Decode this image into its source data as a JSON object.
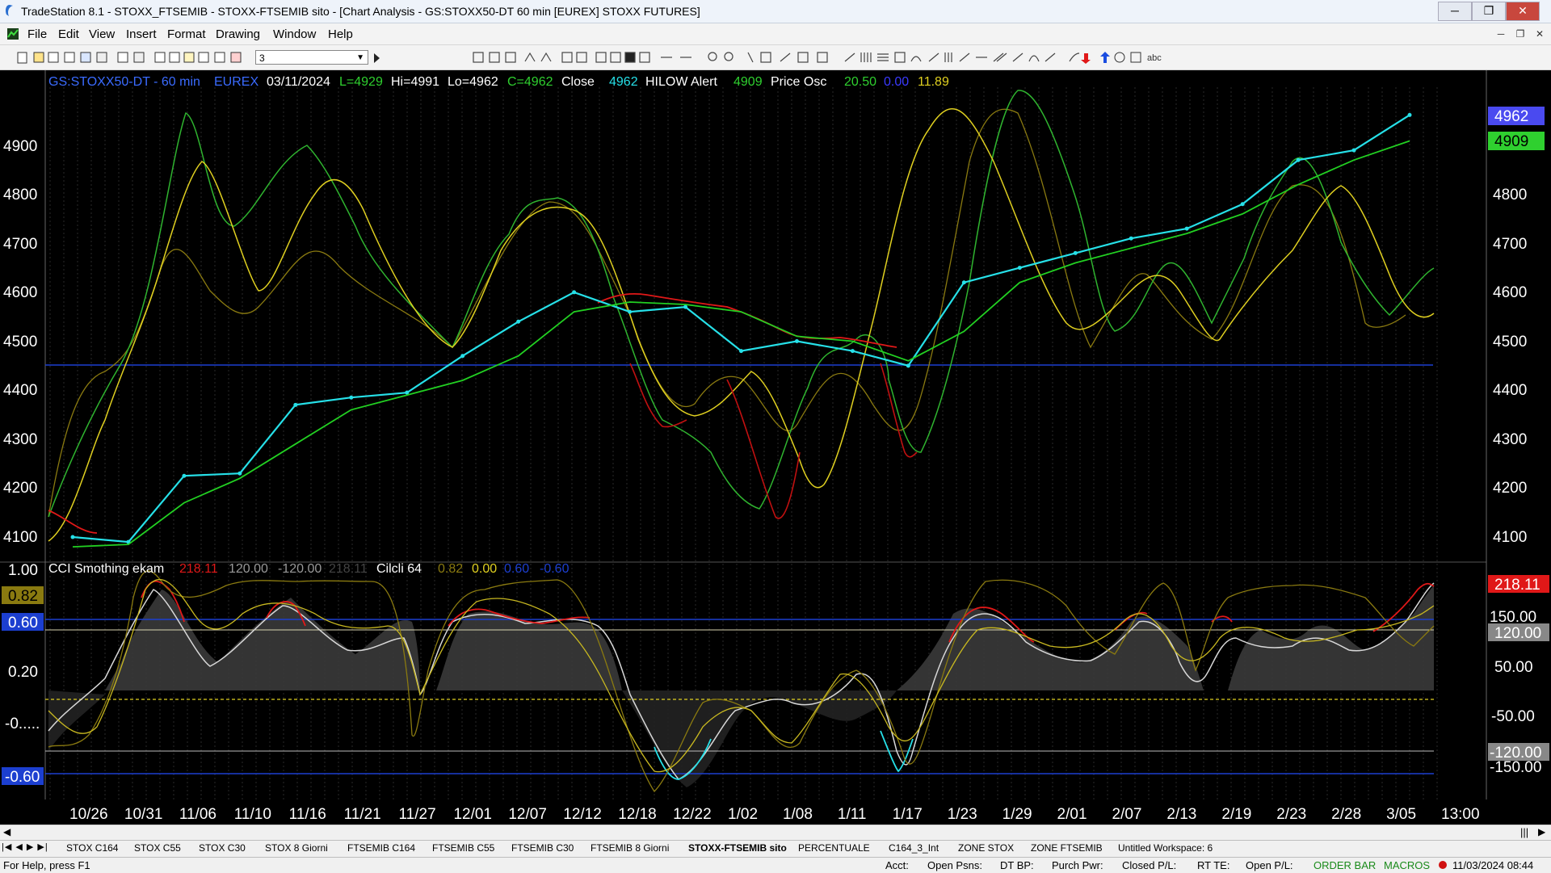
{
  "window": {
    "title": "TradeStation 8.1 - STOXX_FTSEMIB - STOXX-FTSEMIB sito - [Chart Analysis - GS:STOXX50-DT  60 min  [EUREX] STOXX FUTURES]",
    "minimize": "─",
    "maximize": "❐",
    "close": "✕"
  },
  "menu": [
    "File",
    "Edit",
    "View",
    "Insert",
    "Format",
    "Drawing",
    "Window",
    "Help"
  ],
  "toolbar": {
    "interval_value": "3"
  },
  "chart": {
    "header": {
      "symbol": "GS:STOXX50-DT - 60 min",
      "exchange": "EUREX",
      "date": "03/11/2024",
      "low_label": "L=4929",
      "high_label": "Hi=4991",
      "lo_label": "Lo=4962",
      "close_label": "C=4962",
      "close_text": "Close",
      "close_value": "4962",
      "hilow": "HILOW Alert",
      "hilow_value": "4909",
      "price_osc": "Price Osc",
      "osc_v1": "20.50",
      "osc_v2": "0.00",
      "osc_v3": "11.89"
    },
    "price_axis": [
      "4900",
      "4800",
      "4700",
      "4600",
      "4500",
      "4400",
      "4300",
      "4200",
      "4100"
    ],
    "price_badges": {
      "last": "4962",
      "ma": "4909"
    },
    "indicator": {
      "name": "CCI Smothing ekam",
      "v1": "218.11",
      "v2": "120.00",
      "v3": "-120.00",
      "v4": "218.11",
      "name2": "Cilcli 64",
      "w1": "0.82",
      "w2": "0.00",
      "w3": "0.60",
      "w4": "-0.60"
    },
    "left_axis": {
      "top": "1.00",
      "badge_yellow": "0.82",
      "badge_blue": "0.60",
      "mid": "0.20",
      "low": "-0.....",
      "badge_neg": "-0.60"
    },
    "right_axis": {
      "badge_red": "218.11",
      "l150": "150.00",
      "badge_120": "120.00",
      "l50": "50.00",
      "lm50": "-50.00",
      "badge_m120": "-120.00",
      "lm150": "-150.00"
    },
    "dates": [
      "10/26",
      "10/31",
      "11/06",
      "11/10",
      "11/16",
      "11/21",
      "11/27",
      "12/01",
      "12/07",
      "12/12",
      "12/18",
      "12/22",
      "1/02",
      "1/08",
      "1/11",
      "1/17",
      "1/23",
      "1/29",
      "2/01",
      "2/07",
      "2/13",
      "2/19",
      "2/23",
      "2/28",
      "3/05",
      "13:00"
    ]
  },
  "chart_data": {
    "type": "line",
    "x": [
      "10/26",
      "10/31",
      "11/06",
      "11/10",
      "11/16",
      "11/21",
      "11/27",
      "12/01",
      "12/07",
      "12/12",
      "12/18",
      "12/22",
      "1/02",
      "1/08",
      "1/11",
      "1/17",
      "1/23",
      "1/29",
      "2/01",
      "2/07",
      "2/13",
      "2/19",
      "2/23",
      "2/28",
      "3/05"
    ],
    "series": [
      {
        "name": "Close",
        "values": [
          4100,
          4090,
          4225,
          4230,
          4370,
          4385,
          4395,
          4470,
          4540,
          4600,
          4560,
          4570,
          4480,
          4500,
          4480,
          4450,
          4620,
          4650,
          4680,
          4710,
          4730,
          4780,
          4870,
          4890,
          4962
        ]
      },
      {
        "name": "HILOW Alert",
        "values": [
          4080,
          4085,
          4170,
          4220,
          4290,
          4360,
          4390,
          4420,
          4470,
          4560,
          4580,
          4575,
          4560,
          4510,
          4500,
          4460,
          4520,
          4620,
          4660,
          4690,
          4720,
          4760,
          4820,
          4870,
          4909
        ]
      }
    ],
    "ylim": [
      4060,
      5010
    ]
  },
  "tabs": [
    "STOX C164",
    "STOX C55",
    "STOX  C30",
    "STOX  8 Giorni",
    "FTSEMIB C164",
    "FTSEMIB C55",
    "FTSEMIB C30",
    "FTSEMIB  8 Giorni",
    "STOXX-FTSEMIB sito",
    "PERCENTUALE",
    "C164_3_Int",
    "ZONE STOX",
    "ZONE FTSEMIB",
    "Untitled Workspace:  6"
  ],
  "status": {
    "help": "For Help, press F1",
    "acct": "Acct:",
    "open_psns": "Open Psns:",
    "dt_bp": "DT BP:",
    "purch_pwr": "Purch Pwr:",
    "closed_pl": "Closed P/L:",
    "rt_te": "RT TE:",
    "open_pl": "Open P/L:",
    "order_bar": "ORDER BAR",
    "macros": "MACROS",
    "datetime": "11/03/2024 08:44"
  },
  "colors": {
    "price": "#26e0e8",
    "ma": "#22d022",
    "osc_yellow": "#e8d820",
    "osc_green": "#3cb83c",
    "red": "#e01818",
    "bg": "#000000"
  }
}
